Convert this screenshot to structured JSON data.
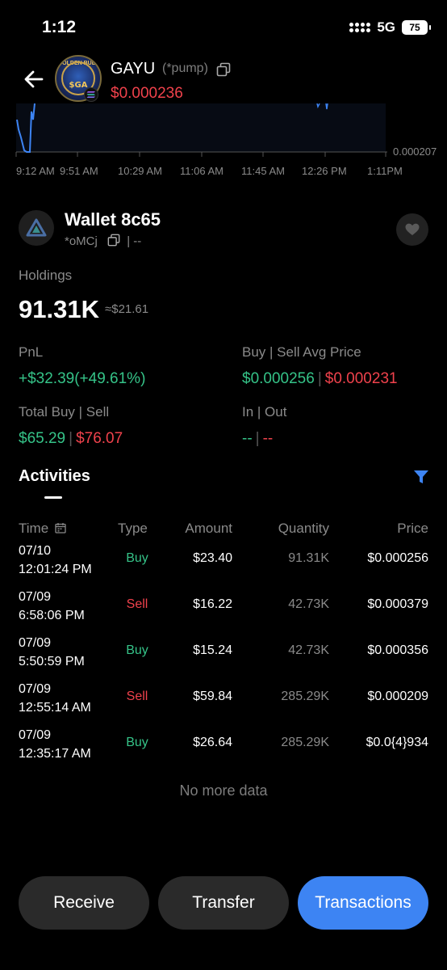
{
  "status_bar": {
    "time": "1:12",
    "network": "5G",
    "battery": "75"
  },
  "token": {
    "name": "GAYU",
    "tag": "(*pump)",
    "price": "$0.000236",
    "avatar_text": "$GA",
    "avatar_top_text": "GOLDEN BULL",
    "price_color": "#f0424c"
  },
  "chart": {
    "x_ticks": [
      "9:12 AM",
      "9:51 AM",
      "10:29 AM",
      "11:06 AM",
      "11:45 AM",
      "12:26 PM",
      "1:11PM"
    ],
    "y_label": "0.000207"
  },
  "wallet": {
    "name": "Wallet 8c65",
    "address_short": "*oMCj",
    "address_extra": "| --",
    "holdings_label": "Holdings",
    "holdings_value": "91.31K",
    "holdings_usd": "≈$21.61",
    "pnl_label": "PnL",
    "pnl_value": "+$32.39(+49.61%)",
    "avg_price_label": "Buy | Sell Avg Price",
    "avg_buy": "$0.000256",
    "avg_sell": "$0.000231",
    "total_label": "Total Buy | Sell",
    "total_buy": "$65.29",
    "total_sell": "$76.07",
    "inout_label": "In | Out",
    "in_value": "--",
    "out_value": "--",
    "separator": "|"
  },
  "activities": {
    "tab_label": "Activities",
    "columns": {
      "time": "Time",
      "type": "Type",
      "amount": "Amount",
      "quantity": "Quantity",
      "price": "Price"
    },
    "rows": [
      {
        "date": "07/10",
        "time": "12:01:24 PM",
        "type": "Buy",
        "amount": "$23.40",
        "quantity": "91.31K",
        "price": "$0.000256"
      },
      {
        "date": "07/09",
        "time": "6:58:06 PM",
        "type": "Sell",
        "amount": "$16.22",
        "quantity": "42.73K",
        "price": "$0.000379"
      },
      {
        "date": "07/09",
        "time": "5:50:59 PM",
        "type": "Buy",
        "amount": "$15.24",
        "quantity": "42.73K",
        "price": "$0.000356"
      },
      {
        "date": "07/09",
        "time": "12:55:14 AM",
        "type": "Sell",
        "amount": "$59.84",
        "quantity": "285.29K",
        "price": "$0.000209"
      },
      {
        "date": "07/09",
        "time": "12:35:17 AM",
        "type": "Buy",
        "amount": "$26.64",
        "quantity": "285.29K",
        "price": "$0.0{4}934"
      }
    ],
    "no_more": "No more data"
  },
  "actions": {
    "receive": "Receive",
    "transfer": "Transfer",
    "transactions": "Transactions"
  },
  "colors": {
    "buy": "#35c388",
    "sell": "#f0424c",
    "accent": "#3d84f3"
  }
}
